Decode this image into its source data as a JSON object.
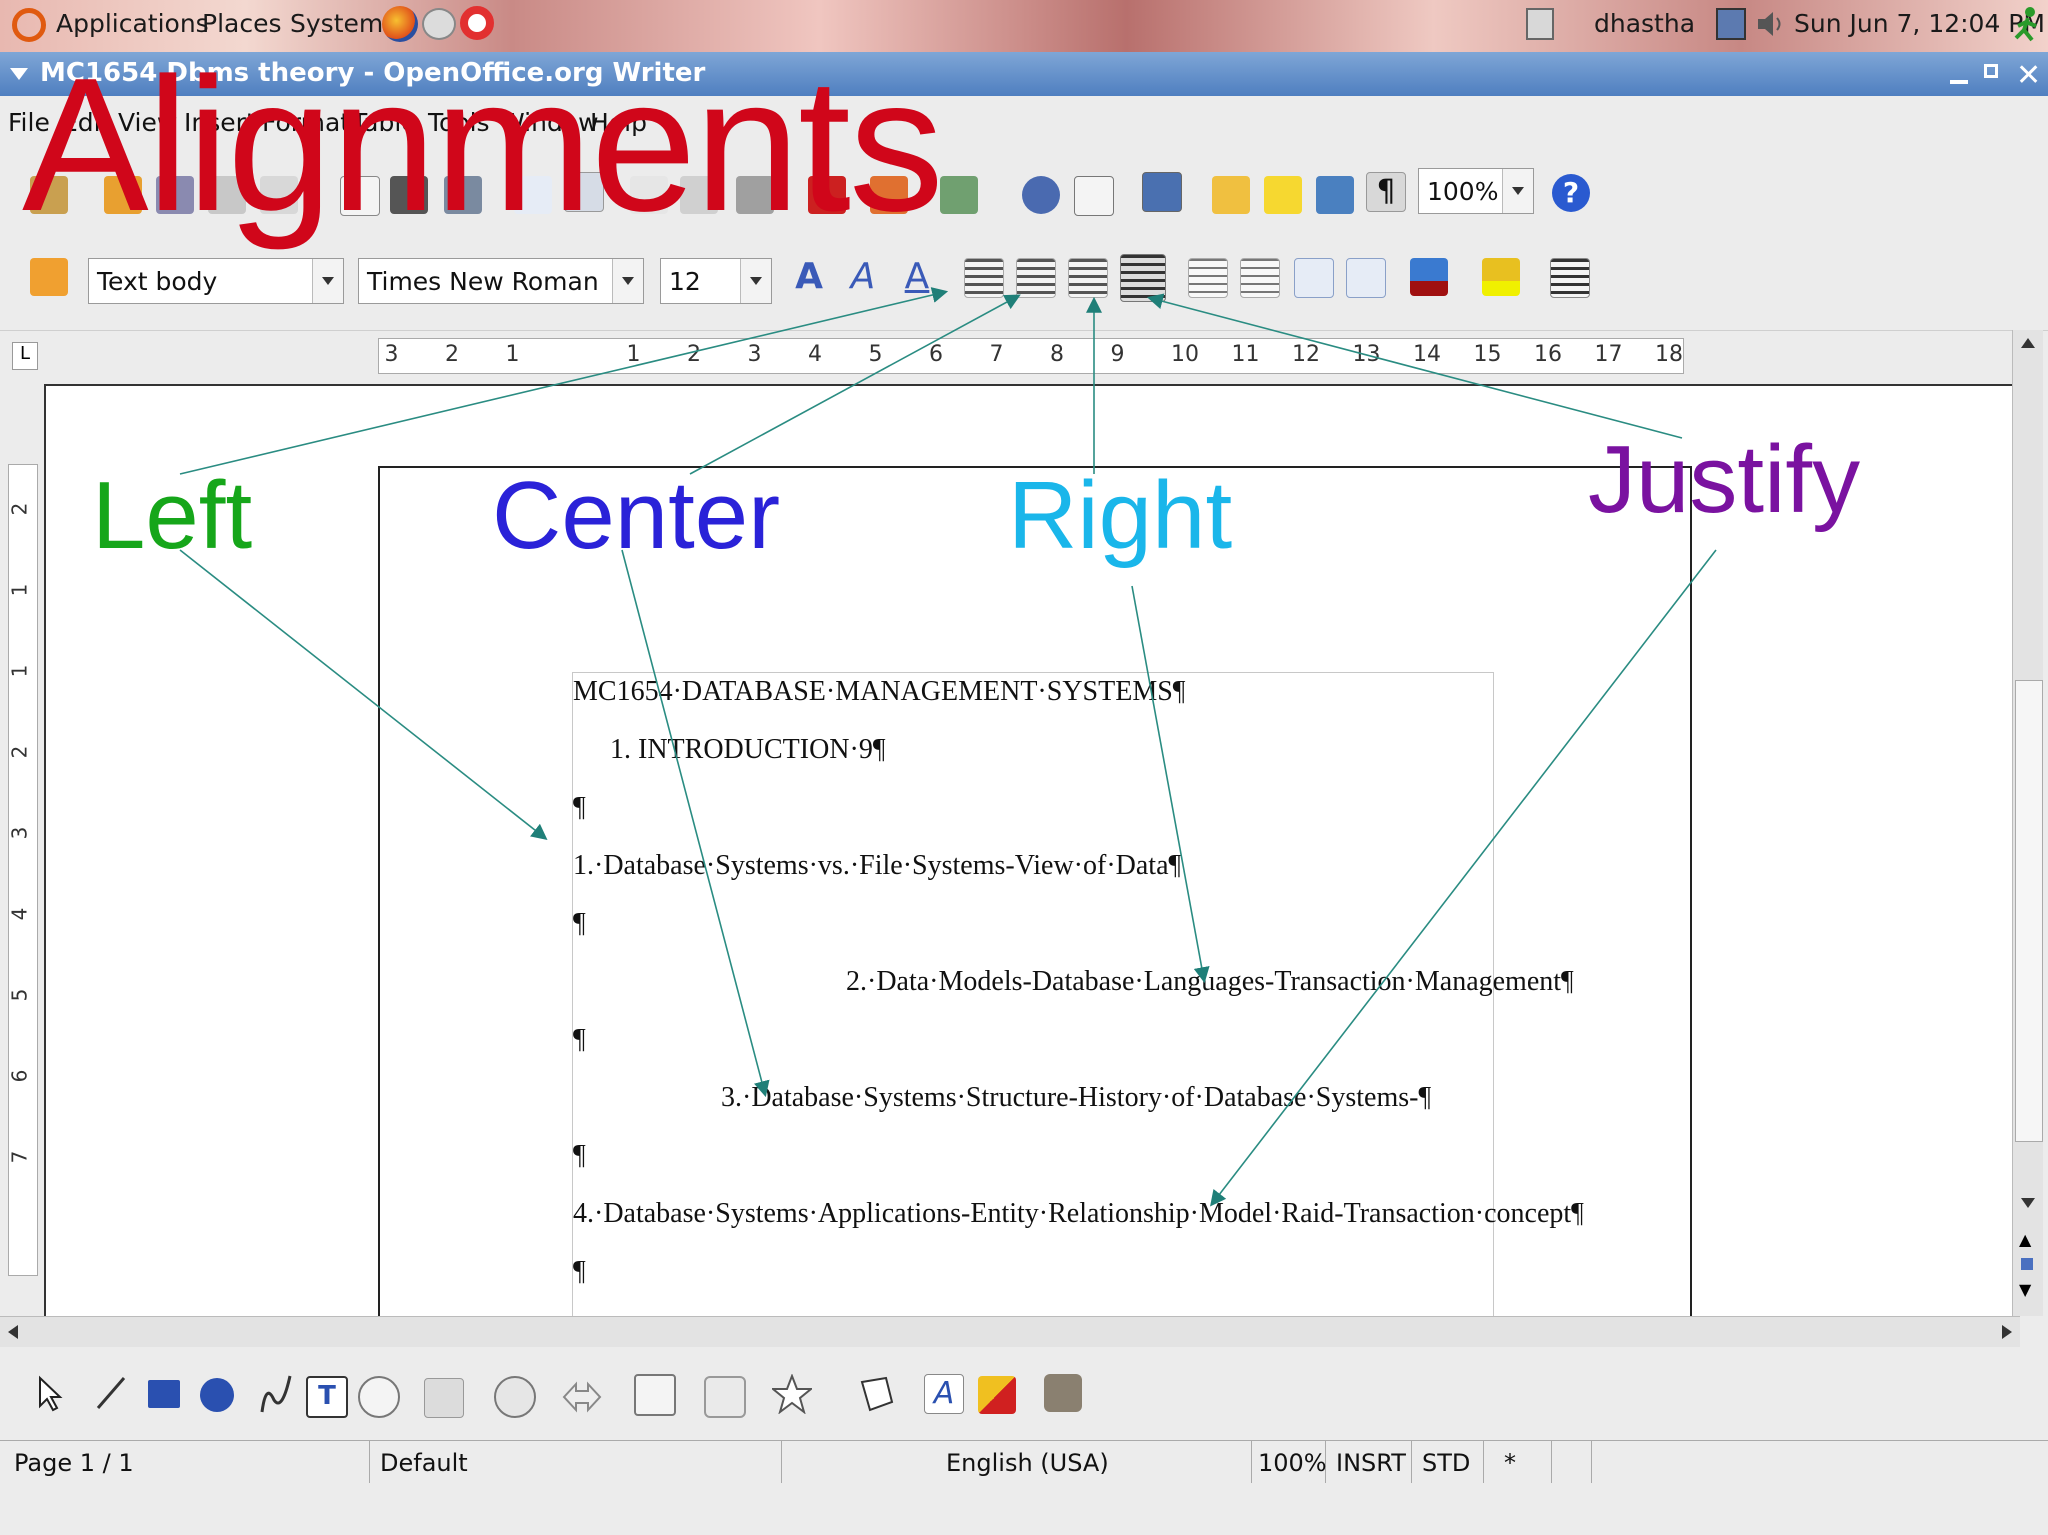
{
  "top_panel": {
    "applications": "Applications",
    "places": "Places",
    "system": "System",
    "user": "dhastha",
    "clock": "Sun Jun  7, 12:04 PM"
  },
  "window": {
    "title": "MC1654 Dbms theory - OpenOffice.org Writer"
  },
  "menu": [
    "File",
    "Edit",
    "View",
    "Insert",
    "Format",
    "Table",
    "Tools",
    "Window",
    "Help"
  ],
  "standard_toolbar": {
    "zoom_value": "100%",
    "pilcrow": "¶"
  },
  "format_toolbar": {
    "style_value": "Text body",
    "font_value": "Times New Roman",
    "size_value": "12"
  },
  "ruler": {
    "labels": [
      "3",
      "2",
      "1",
      "1",
      "2",
      "3",
      "4",
      "5",
      "6",
      "7",
      "8",
      "9",
      "10",
      "11",
      "12",
      "13",
      "14",
      "15",
      "16",
      "17",
      "18"
    ],
    "vertical_labels": [
      "2",
      "1",
      "1",
      "2",
      "3",
      "4",
      "5",
      "6",
      "7"
    ]
  },
  "document": {
    "lines": [
      "MC1654·DATABASE·MANAGEMENT·SYSTEMS¶",
      "1.   INTRODUCTION·9¶",
      "¶",
      "1.·Database·Systems·vs.·File·Systems-View·of·Data¶",
      "¶",
      "2.·Data·Models-Database·Languages-Transaction·Management¶",
      "¶",
      "3.·Database·Systems·Structure-History·of·Database·Systems-¶",
      "¶",
      "4.·Database·Systems·Applications-Entity·Relationship·Model·Raid-Transaction·concept¶",
      "¶"
    ]
  },
  "status_bar": {
    "page": "Page 1 / 1",
    "style": "Default",
    "language": "English (USA)",
    "zoom": "100%",
    "insert_mode": "INSRT",
    "selection_mode": "STD",
    "modified": "*"
  },
  "annotations": {
    "heading": "Alignments",
    "left": "Left",
    "center": "Center",
    "right": "Right",
    "justify": "Justify",
    "colors": {
      "heading": "#d0061a",
      "left": "#16a61a",
      "center": "#2a22d8",
      "right": "#1ab6ea",
      "justify": "#7a12a0",
      "arrows": "#2a8c82"
    }
  }
}
